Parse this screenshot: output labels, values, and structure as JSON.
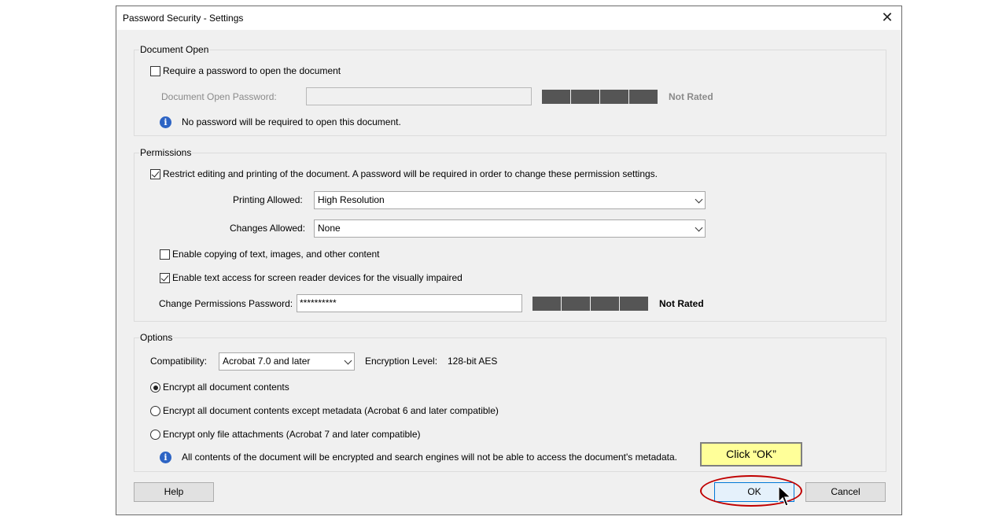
{
  "window": {
    "title": "Password Security - Settings"
  },
  "document_open": {
    "group_label": "Document Open",
    "require_password_label": "Require a password to open the document",
    "require_password_checked": false,
    "password_label": "Document Open Password:",
    "password_value": "",
    "strength_label": "Not Rated",
    "info_text": "No password will be required to open this document."
  },
  "permissions": {
    "group_label": "Permissions",
    "restrict_label": "Restrict editing and printing of the document. A password will be required in order to change these permission settings.",
    "restrict_checked": true,
    "printing_label": "Printing Allowed:",
    "printing_value": "High Resolution",
    "changes_label": "Changes Allowed:",
    "changes_value": "None",
    "enable_copy_label": "Enable copying of text, images, and other content",
    "enable_copy_checked": false,
    "enable_screen_reader_label": "Enable text access for screen reader devices for the visually impaired",
    "enable_screen_reader_checked": true,
    "perm_password_label": "Change Permissions Password:",
    "perm_password_value": "**********",
    "strength_label": "Not Rated"
  },
  "options": {
    "group_label": "Options",
    "compat_label": "Compatibility:",
    "compat_value": "Acrobat 7.0 and later",
    "encryption_label": "Encryption  Level:",
    "encryption_value": "128-bit AES",
    "radio_all": "Encrypt all document contents",
    "radio_except_metadata": "Encrypt all document contents except metadata (Acrobat 6 and later compatible)",
    "radio_attachments": "Encrypt only file attachments (Acrobat 7 and later compatible)",
    "selected_radio": "all",
    "info_text": "All contents of the document will be encrypted and search engines will not be able to access the document's metadata."
  },
  "buttons": {
    "help": "Help",
    "ok": "OK",
    "cancel": "Cancel"
  },
  "callout": {
    "text": "Click “OK”"
  },
  "icons": {
    "close": "close-icon",
    "info": "info-icon",
    "dropdown": "chevron-down-icon",
    "cursor": "mouse-pointer-icon"
  },
  "colors": {
    "strength_bar": "#555555",
    "info_icon": "#2d64c4",
    "callout_bg": "#ffff99",
    "highlight": "#c00000",
    "ok_border": "#0078d7"
  }
}
